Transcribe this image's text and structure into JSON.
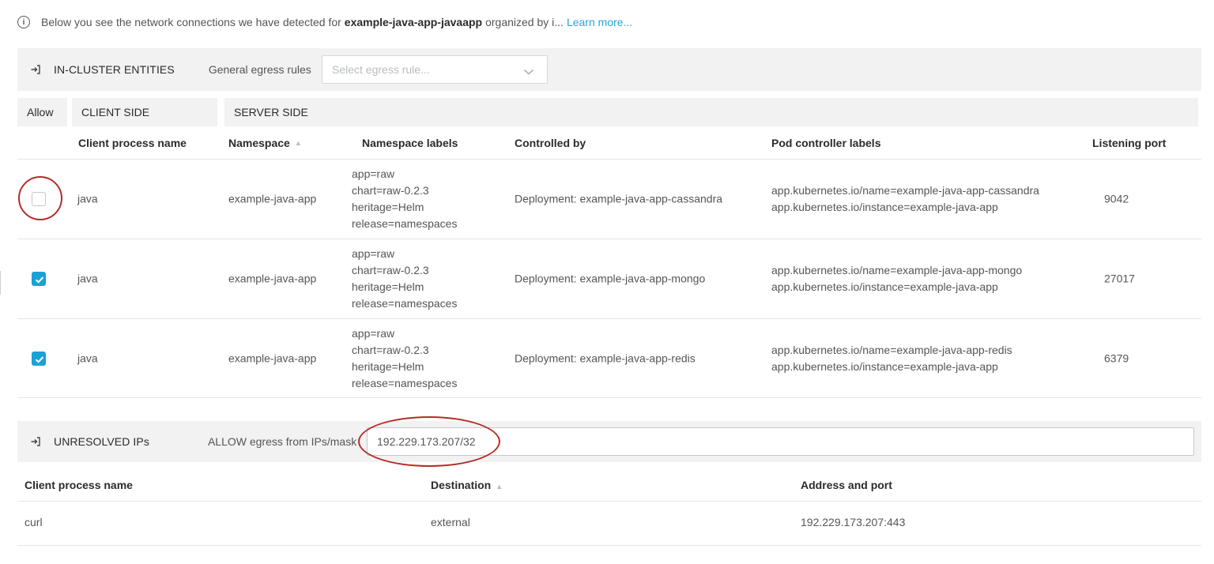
{
  "info": {
    "prefix": "Below you see the network connections we have detected for",
    "app_name": "example-java-app-javaapp",
    "suffix": "organized by i...",
    "learn_more": "Learn more..."
  },
  "in_cluster": {
    "title": "IN-CLUSTER ENTITIES",
    "egress_label": "General egress rules",
    "select_placeholder": "Select egress rule...",
    "groups": {
      "allow": "Allow",
      "client": "CLIENT SIDE",
      "server": "SERVER SIDE"
    },
    "columns": {
      "client_process": "Client process name",
      "namespace": "Namespace",
      "namespace_labels": "Namespace labels",
      "controlled_by": "Controlled by",
      "pod_controller_labels": "Pod controller labels",
      "listening_port": "Listening port"
    },
    "rows": [
      {
        "allowed": false,
        "client_process": "java",
        "namespace": "example-java-app",
        "labels": [
          "app=raw",
          "chart=raw-0.2.3",
          "heritage=Helm",
          "release=namespaces"
        ],
        "controlled_by": "Deployment: example-java-app-cassandra",
        "pod_labels": [
          "app.kubernetes.io/name=example-java-app-cassandra",
          "app.kubernetes.io/instance=example-java-app"
        ],
        "port": "9042"
      },
      {
        "allowed": true,
        "client_process": "java",
        "namespace": "example-java-app",
        "labels": [
          "app=raw",
          "chart=raw-0.2.3",
          "heritage=Helm",
          "release=namespaces"
        ],
        "controlled_by": "Deployment: example-java-app-mongo",
        "pod_labels": [
          "app.kubernetes.io/name=example-java-app-mongo",
          "app.kubernetes.io/instance=example-java-app"
        ],
        "port": "27017"
      },
      {
        "allowed": true,
        "client_process": "java",
        "namespace": "example-java-app",
        "labels": [
          "app=raw",
          "chart=raw-0.2.3",
          "heritage=Helm",
          "release=namespaces"
        ],
        "controlled_by": "Deployment: example-java-app-redis",
        "pod_labels": [
          "app.kubernetes.io/name=example-java-app-redis",
          "app.kubernetes.io/instance=example-java-app"
        ],
        "port": "6379"
      }
    ]
  },
  "unresolved": {
    "title": "UNRESOLVED IPs",
    "allow_label": "ALLOW egress from IPs/mask",
    "ip_value": "192.229.173.207/32",
    "columns": {
      "client_process": "Client process name",
      "destination": "Destination",
      "address_port": "Address and port"
    },
    "rows": [
      {
        "client_process": "curl",
        "destination": "external",
        "address_port": "192.229.173.207:443"
      }
    ]
  },
  "colors": {
    "accent": "#1aa1d8",
    "link": "#26a7d9",
    "annotation": "#b42d28"
  },
  "icons": {
    "info": "info-circle-icon",
    "section": "exit-arrow-icon",
    "sort": "sort-up-icon",
    "dropdown": "chevron-down-icon"
  }
}
